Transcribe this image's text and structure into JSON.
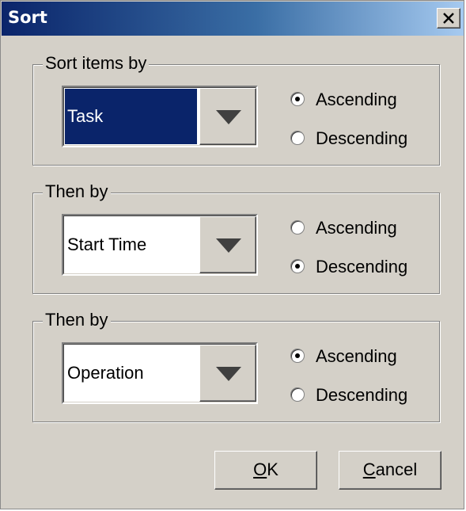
{
  "window": {
    "title": "Sort",
    "close_label": "×"
  },
  "groups": [
    {
      "legend": "Sort items by",
      "field": "Task",
      "selected_field": true,
      "order": "Ascending"
    },
    {
      "legend": "Then by",
      "field": "Start Time",
      "selected_field": false,
      "order": "Descending"
    },
    {
      "legend": "Then by",
      "field": "Operation",
      "selected_field": false,
      "order": "Ascending"
    }
  ],
  "radio_labels": {
    "ascending": "Ascending",
    "descending": "Descending"
  },
  "buttons": {
    "ok": {
      "mnemonic": "O",
      "rest": "K"
    },
    "cancel": {
      "mnemonic": "C",
      "rest": "ancel"
    }
  },
  "icons": {
    "close": "close-icon",
    "dropdown": "triangle-down-icon",
    "radio": "radio-icon"
  },
  "colors": {
    "title_start": "#0a246a",
    "title_end": "#a6caf0",
    "face": "#d4d0c8",
    "selection": "#0a246a"
  }
}
